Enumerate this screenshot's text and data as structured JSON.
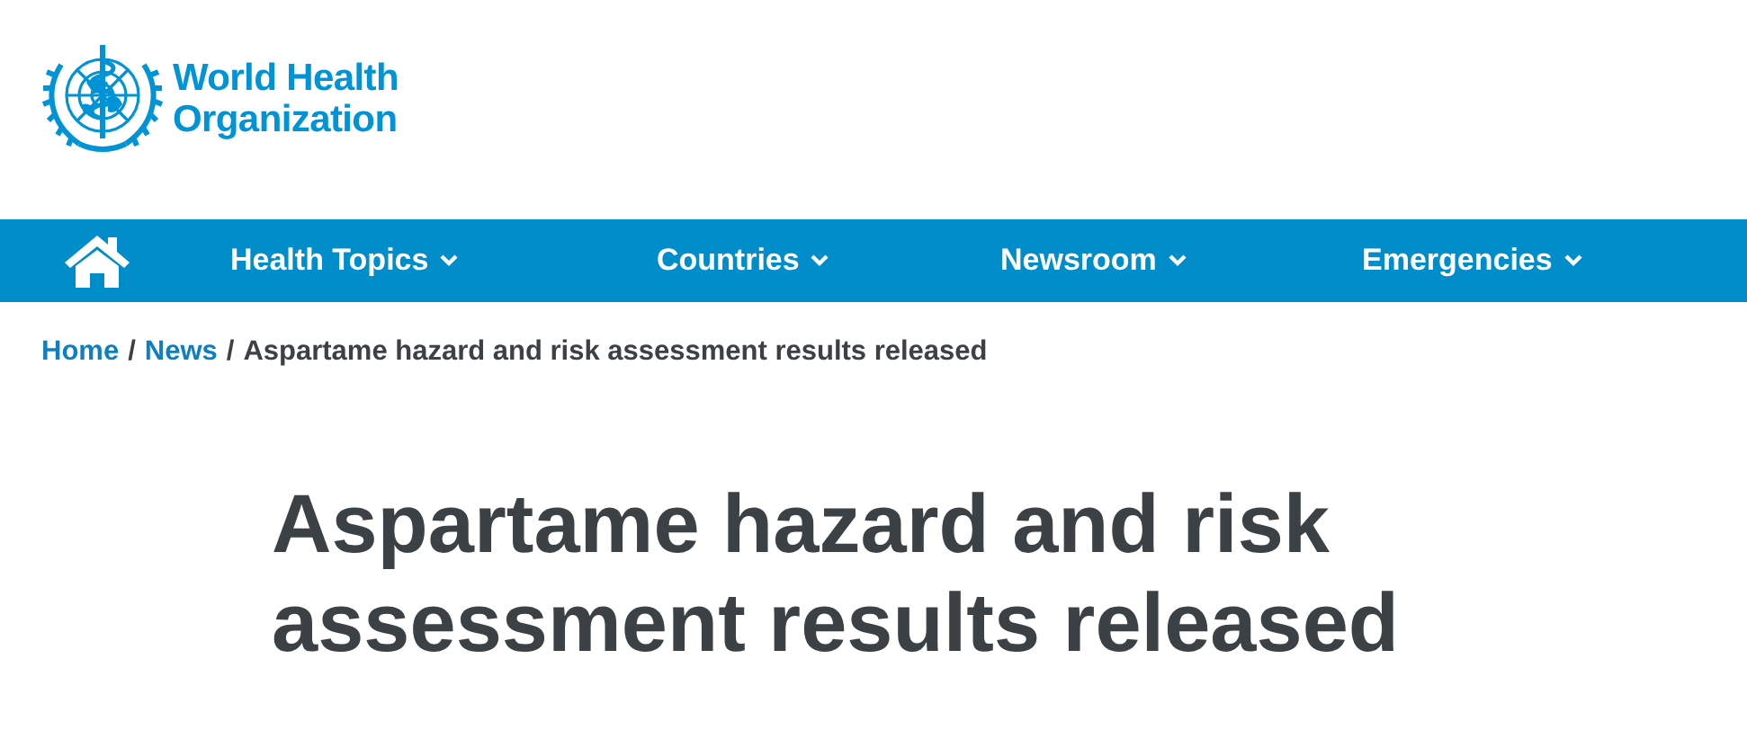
{
  "logo": {
    "lines": [
      "World Health",
      "Organization"
    ]
  },
  "nav": {
    "items": [
      {
        "label": "Health Topics",
        "has_menu": true
      },
      {
        "label": "Countries",
        "has_menu": true
      },
      {
        "label": "Newsroom",
        "has_menu": true
      },
      {
        "label": "Emergencies",
        "has_menu": true
      }
    ]
  },
  "breadcrumb": [
    {
      "kind": "link",
      "label": "Home"
    },
    {
      "kind": "separator",
      "label": "/"
    },
    {
      "kind": "link",
      "label": "News"
    },
    {
      "kind": "separator",
      "label": "/"
    },
    {
      "kind": "current",
      "label": "Aspartame hazard and risk assessment results released"
    }
  ],
  "article": {
    "title": "Aspartame hazard and risk assessment results released"
  }
}
